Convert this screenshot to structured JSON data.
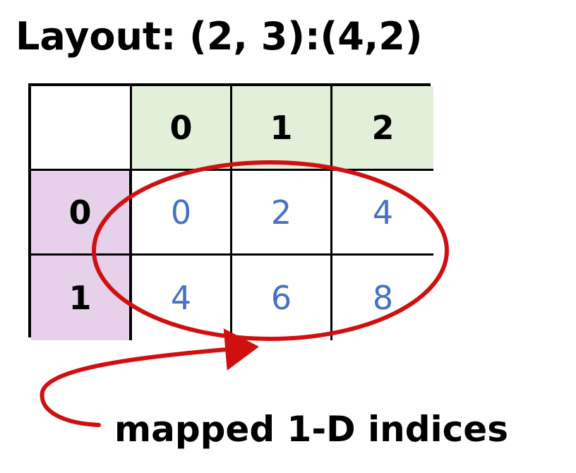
{
  "title": "Layout: (2, 3):(4,2)",
  "table": {
    "corner": "",
    "column_headers": [
      "0",
      "1",
      "2"
    ],
    "row_headers": [
      "0",
      "1"
    ],
    "rows": [
      [
        "0",
        "2",
        "4"
      ],
      [
        "4",
        "6",
        "8"
      ]
    ]
  },
  "annotation": {
    "caption": "mapped 1-D indices"
  },
  "colors": {
    "column_header_fill": "#e2f0d9",
    "row_header_fill": "#e6d0ea",
    "value_text": "#4472c4",
    "annotation_stroke": "#d01010"
  }
}
